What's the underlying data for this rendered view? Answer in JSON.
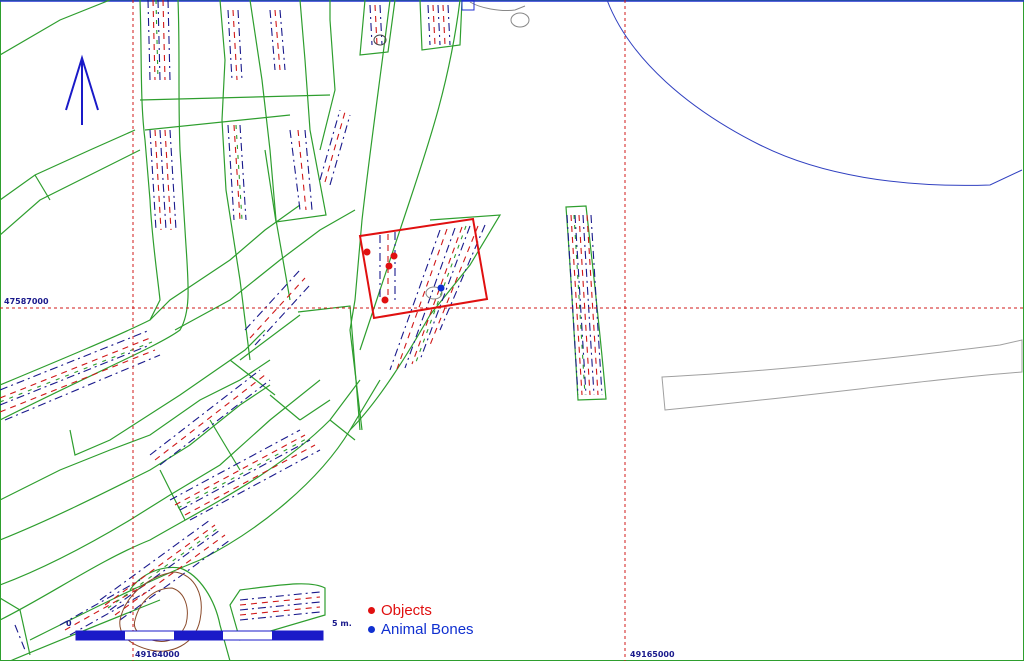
{
  "map": {
    "grid_labels": {
      "northing": "47587000",
      "easting_left": "49164000",
      "easting_right": "49165000"
    },
    "scale_bar": {
      "start_label": "0",
      "end_label": "5 m."
    },
    "legend": {
      "items": [
        {
          "label": "Objects",
          "color": "#e01010"
        },
        {
          "label": "Animal Bones",
          "color": "#1030d0"
        }
      ]
    },
    "colors": {
      "trench_outline": "#2e9e2e",
      "grid": "#d01818",
      "selection_box": "#e01010",
      "contour": "#3040c0",
      "north_arrow": "#1a1ac8"
    },
    "icons": [
      "north-arrow-icon"
    ]
  }
}
